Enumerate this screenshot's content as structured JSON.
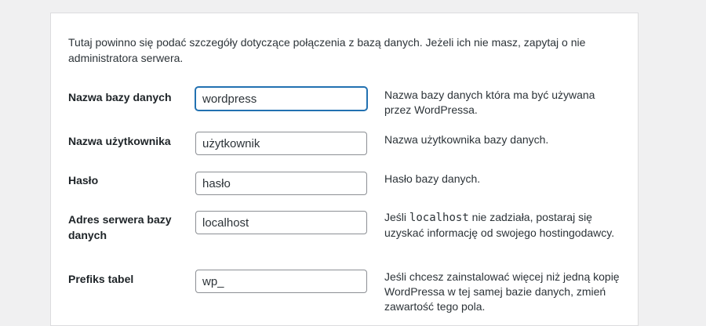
{
  "intro": "Tutaj powinno się podać szczegóły dotyczące połączenia z bazą danych. Jeżeli ich nie masz, zapytaj o nie administratora serwera.",
  "fields": [
    {
      "label": "Nazwa bazy danych",
      "value": "wordpress",
      "description": "Nazwa bazy danych która ma być używana przez WordPressa.",
      "focused": true
    },
    {
      "label": "Nazwa użytkownika",
      "value": "użytkownik",
      "description": "Nazwa użytkownika bazy danych."
    },
    {
      "label": "Hasło",
      "value": "hasło",
      "description": "Hasło bazy danych."
    },
    {
      "label": "Adres serwera bazy danych",
      "value": "localhost",
      "description_pre": "Jeśli",
      "description_code": "localhost",
      "description_post": "nie zadziała, postaraj się uzyskać informację od swojego hostingodawcy."
    },
    {
      "label": "Prefiks tabel",
      "value": "wp_",
      "description": "Jeśli chcesz zainstalować więcej niż jedną kopię WordPressa w tej samej bazie danych, zmień zawartość tego pola."
    }
  ],
  "colors": {
    "focus": "#2271b1",
    "background": "#f0f0f1",
    "panel": "#ffffff"
  }
}
